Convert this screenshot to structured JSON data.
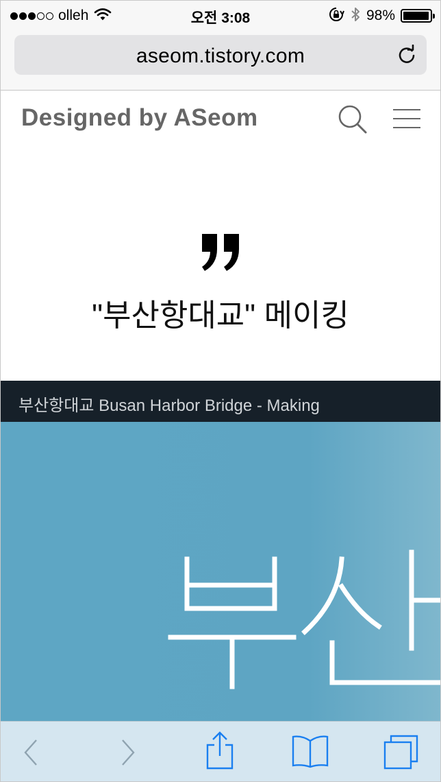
{
  "status_bar": {
    "signal_bars_filled": 3,
    "signal_bars_total": 5,
    "carrier": "olleh",
    "time": "오전 3:08",
    "battery_percent": "98%",
    "battery_level": 0.98,
    "icons": [
      "wifi-icon",
      "orientation-lock-icon",
      "bluetooth-icon",
      "battery-icon"
    ]
  },
  "browser": {
    "url": "aseom.tistory.com",
    "reload_icon": "reload-icon"
  },
  "site": {
    "title": "Designed by ASeom",
    "search_icon": "search-icon",
    "menu_icon": "hamburger-menu-icon"
  },
  "post": {
    "quote_icon": "closing-quote-icon",
    "title": "\"부산항대교\" 메이킹",
    "caption": "부산항대교 Busan Harbor Bridge - Making"
  },
  "toolbar": {
    "icons": [
      "back-icon",
      "forward-icon",
      "share-icon",
      "bookmarks-icon",
      "tabs-icon"
    ]
  },
  "colors": {
    "status_bg": "#f7f7f7",
    "url_field_bg": "#e3e3e5",
    "site_title": "#666666",
    "caption_bg": "#162029",
    "hero_bg": "#5ea6c4",
    "toolbar_bg": "#d5e6f0",
    "toolbar_icon": "#1a7ff0"
  }
}
